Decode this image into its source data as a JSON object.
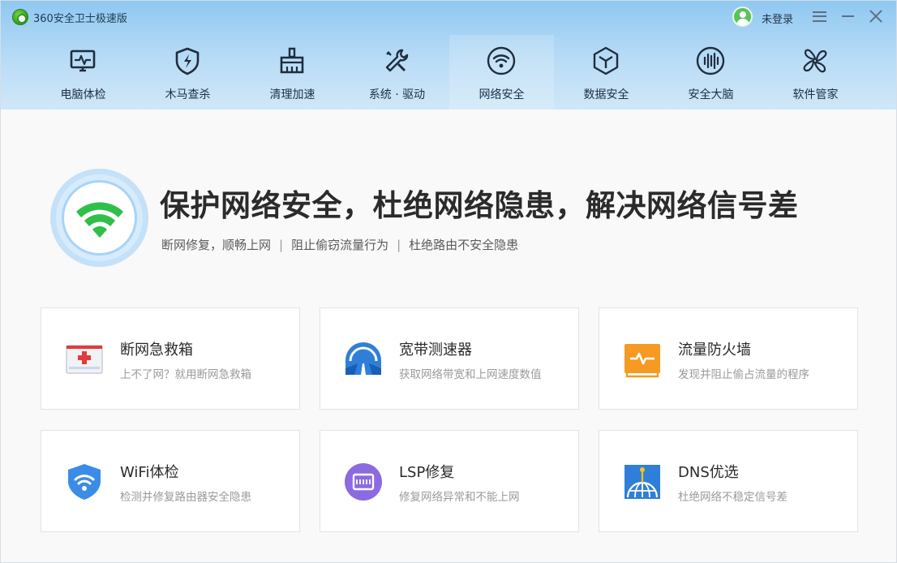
{
  "app": {
    "title": "360安全卫士极速版",
    "login_label": "未登录"
  },
  "nav": {
    "active_index": 4,
    "items": [
      {
        "label": "电脑体检",
        "icon": "monitor-pulse-icon"
      },
      {
        "label": "木马查杀",
        "icon": "shield-bolt-icon"
      },
      {
        "label": "清理加速",
        "icon": "broom-icon"
      },
      {
        "label": "系统 · 驱动",
        "icon": "wrench-screwdriver-icon"
      },
      {
        "label": "网络安全",
        "icon": "wifi-icon"
      },
      {
        "label": "数据安全",
        "icon": "data-cube-icon"
      },
      {
        "label": "安全大脑",
        "icon": "brain-icon"
      },
      {
        "label": "软件管家",
        "icon": "grid-flower-icon"
      }
    ]
  },
  "hero": {
    "title": "保护网络安全，杜绝网络隐患，解决网络信号差",
    "sub1": "断网修复，顺畅上网",
    "sub2": "阻止偷窃流量行为",
    "sub3": "杜绝路由不安全隐患",
    "separator": "|"
  },
  "tools": [
    {
      "title": "断网急救箱",
      "desc": "上不了网？就用断网急救箱",
      "icon": "first-aid-kit-icon"
    },
    {
      "title": "宽带测速器",
      "desc": "获取网络带宽和上网速度数值",
      "icon": "speedometer-road-icon"
    },
    {
      "title": "流量防火墙",
      "desc": "发现并阻止偷占流量的程序",
      "icon": "firewall-pulse-icon"
    },
    {
      "title": "WiFi体检",
      "desc": "检测并修复路由器安全隐患",
      "icon": "wifi-shield-icon"
    },
    {
      "title": "LSP修复",
      "desc": "修复网络异常和不能上网",
      "icon": "lsp-chip-icon"
    },
    {
      "title": "DNS优选",
      "desc": "杜绝网络不稳定信号差",
      "icon": "dns-globe-icon"
    }
  ],
  "colors": {
    "header_top": "#8fc8f1",
    "header_bottom": "#cfe7f8",
    "wifi_green": "#2fbf4a",
    "first_aid_red": "#e23b3b",
    "speed_blue": "#2f7fd9",
    "firewall_orange": "#f59a22",
    "wifi_shield_blue": "#3a8ce6",
    "lsp_purple": "#8c6ae0",
    "dns_blue": "#2f7fd9"
  }
}
